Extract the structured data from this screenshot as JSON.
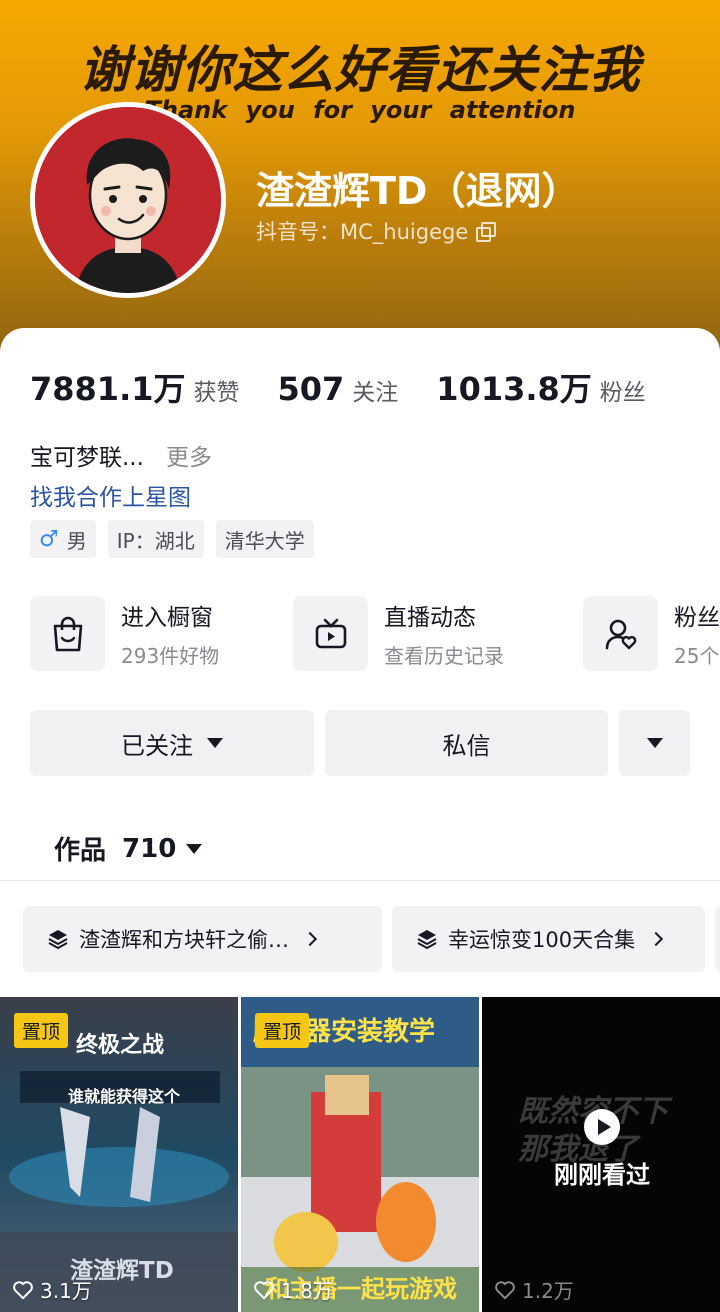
{
  "banner": {
    "title": "谢谢你这么好看还关注我",
    "subtitle": "Thank you for your attention"
  },
  "profile": {
    "nickname": "渣渣辉TD（退网）",
    "douyin_id": "抖音号：MC_huigege"
  },
  "stats": [
    {
      "value": "7881.1万",
      "label": "获赞"
    },
    {
      "value": "507",
      "label": "关注"
    },
    {
      "value": "1013.8万",
      "label": "粉丝"
    }
  ],
  "bio": {
    "text": "宝可梦联...",
    "more": "更多",
    "link": "找我合作上星图"
  },
  "tags": {
    "gender": "男",
    "ip": "IP：湖北",
    "school": "清华大学"
  },
  "entries": [
    {
      "icon": "shopping-bag-icon",
      "title": "进入橱窗",
      "sub": "293件好物"
    },
    {
      "icon": "tv-icon",
      "title": "直播动态",
      "sub": "查看历史记录"
    },
    {
      "icon": "user-heart-icon",
      "title": "粉丝",
      "sub": "25个"
    }
  ],
  "actions": {
    "follow": "已关注",
    "message": "私信"
  },
  "works": {
    "label": "作品",
    "count": "710"
  },
  "collections": [
    {
      "icon": "layers-icon",
      "name": "渣渣辉和方块轩之偷…"
    },
    {
      "icon": "layers-icon",
      "name": "幸运惊变100天合集"
    }
  ],
  "videos": [
    {
      "pinned": "置顶",
      "title_top": "终极之战",
      "caption": "谁就能获得这个",
      "title_bottom": "渣渣辉TD",
      "likes": "3.1万"
    },
    {
      "pinned": "置顶",
      "title_top": "脑袋器安装教学",
      "title_bottom": "和主播一起玩游戏",
      "likes": "1.8万"
    },
    {
      "overlay_text": "既然容不下 那我退了",
      "recent_label": "刚刚看过",
      "likes": "1.2万"
    }
  ],
  "colors": {
    "banner_top": "#f6a800",
    "link": "#2d55a5",
    "pin": "#f6c615",
    "avatar_bg": "#c1272d"
  }
}
